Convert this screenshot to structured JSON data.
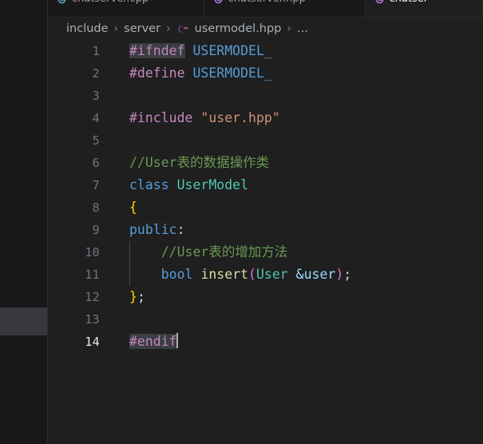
{
  "window": {
    "theme": "dark-plus",
    "background": "#1f1f1f",
    "sidebar_background": "#181818"
  },
  "tabs": [
    {
      "label": "chatserver.cpp",
      "icon": "cpp-file-icon",
      "icon_color": "#519aba",
      "active": false
    },
    {
      "label": "chatserver.hpp",
      "icon": "hpp-file-icon",
      "icon_color": "#a074c4",
      "active": false
    },
    {
      "label": "chatser",
      "icon": "hpp-file-icon",
      "icon_color": "#a074c4",
      "active": true
    }
  ],
  "breadcrumb": {
    "separator": "›",
    "items": [
      {
        "label": "include",
        "icon": null
      },
      {
        "label": "server",
        "icon": null
      },
      {
        "label": "usermodel.hpp",
        "icon": "cpp-language-icon"
      },
      {
        "label": "...",
        "icon": null
      }
    ]
  },
  "editor": {
    "file": "usermodel.hpp",
    "active_line": 14,
    "lines": [
      {
        "num": "1",
        "indent": 0,
        "guide": false,
        "tokens": [
          {
            "text": "#ifndef",
            "class": "t-pre",
            "selected": true
          },
          {
            "text": " ",
            "class": "t-plain"
          },
          {
            "text": "USERMODEL_",
            "class": "t-macro"
          }
        ]
      },
      {
        "num": "2",
        "indent": 0,
        "guide": false,
        "tokens": [
          {
            "text": "#define",
            "class": "t-pre"
          },
          {
            "text": " ",
            "class": "t-plain"
          },
          {
            "text": "USERMODEL_",
            "class": "t-macro"
          }
        ]
      },
      {
        "num": "3",
        "indent": 0,
        "guide": false,
        "tokens": []
      },
      {
        "num": "4",
        "indent": 0,
        "guide": false,
        "tokens": [
          {
            "text": "#include",
            "class": "t-pre"
          },
          {
            "text": " ",
            "class": "t-plain"
          },
          {
            "text": "\"user.hpp\"",
            "class": "t-str"
          }
        ]
      },
      {
        "num": "5",
        "indent": 0,
        "guide": false,
        "tokens": []
      },
      {
        "num": "6",
        "indent": 0,
        "guide": false,
        "tokens": [
          {
            "text": "//User表的数据操作类",
            "class": "t-cmt"
          }
        ]
      },
      {
        "num": "7",
        "indent": 0,
        "guide": false,
        "tokens": [
          {
            "text": "class",
            "class": "t-kw"
          },
          {
            "text": " ",
            "class": "t-plain"
          },
          {
            "text": "UserModel",
            "class": "t-type"
          }
        ]
      },
      {
        "num": "8",
        "indent": 0,
        "guide": false,
        "tokens": [
          {
            "text": "{",
            "class": "t-brace"
          }
        ]
      },
      {
        "num": "9",
        "indent": 0,
        "guide": false,
        "tokens": [
          {
            "text": "public",
            "class": "t-kw"
          },
          {
            "text": ":",
            "class": "t-plain"
          }
        ]
      },
      {
        "num": "10",
        "indent": 1,
        "guide": true,
        "tokens": [
          {
            "text": "    //User表的增加方法",
            "class": "t-cmt"
          }
        ]
      },
      {
        "num": "11",
        "indent": 1,
        "guide": true,
        "tokens": [
          {
            "text": "    ",
            "class": "t-plain"
          },
          {
            "text": "bool",
            "class": "t-kw"
          },
          {
            "text": " ",
            "class": "t-plain"
          },
          {
            "text": "insert",
            "class": "t-fn"
          },
          {
            "text": "(",
            "class": "t-punct"
          },
          {
            "text": "User",
            "class": "t-type"
          },
          {
            "text": " ",
            "class": "t-plain"
          },
          {
            "text": "&user",
            "class": "t-var"
          },
          {
            "text": ")",
            "class": "t-punct"
          },
          {
            "text": ";",
            "class": "t-plain"
          }
        ]
      },
      {
        "num": "12",
        "indent": 0,
        "guide": false,
        "tokens": [
          {
            "text": "}",
            "class": "t-brace"
          },
          {
            "text": ";",
            "class": "t-plain"
          }
        ]
      },
      {
        "num": "13",
        "indent": 0,
        "guide": false,
        "tokens": []
      },
      {
        "num": "14",
        "indent": 0,
        "guide": false,
        "active": true,
        "caret": true,
        "tokens": [
          {
            "text": "#endif",
            "class": "t-pre",
            "selected": true
          }
        ]
      }
    ]
  },
  "colors": {
    "preprocessor": "#c586c0",
    "macro": "#569cd6",
    "string": "#ce9178",
    "comment": "#6a9955",
    "keyword": "#569cd6",
    "type": "#4ec9b0",
    "function": "#dcdcaa",
    "punctuation": "#da70d6",
    "variable": "#9cdcfe",
    "brace": "#ffd700",
    "selection_match": "#3a3d41",
    "line_number": "#6e7681",
    "active_line_number": "#e6edf3",
    "caret": "#aeafad"
  }
}
